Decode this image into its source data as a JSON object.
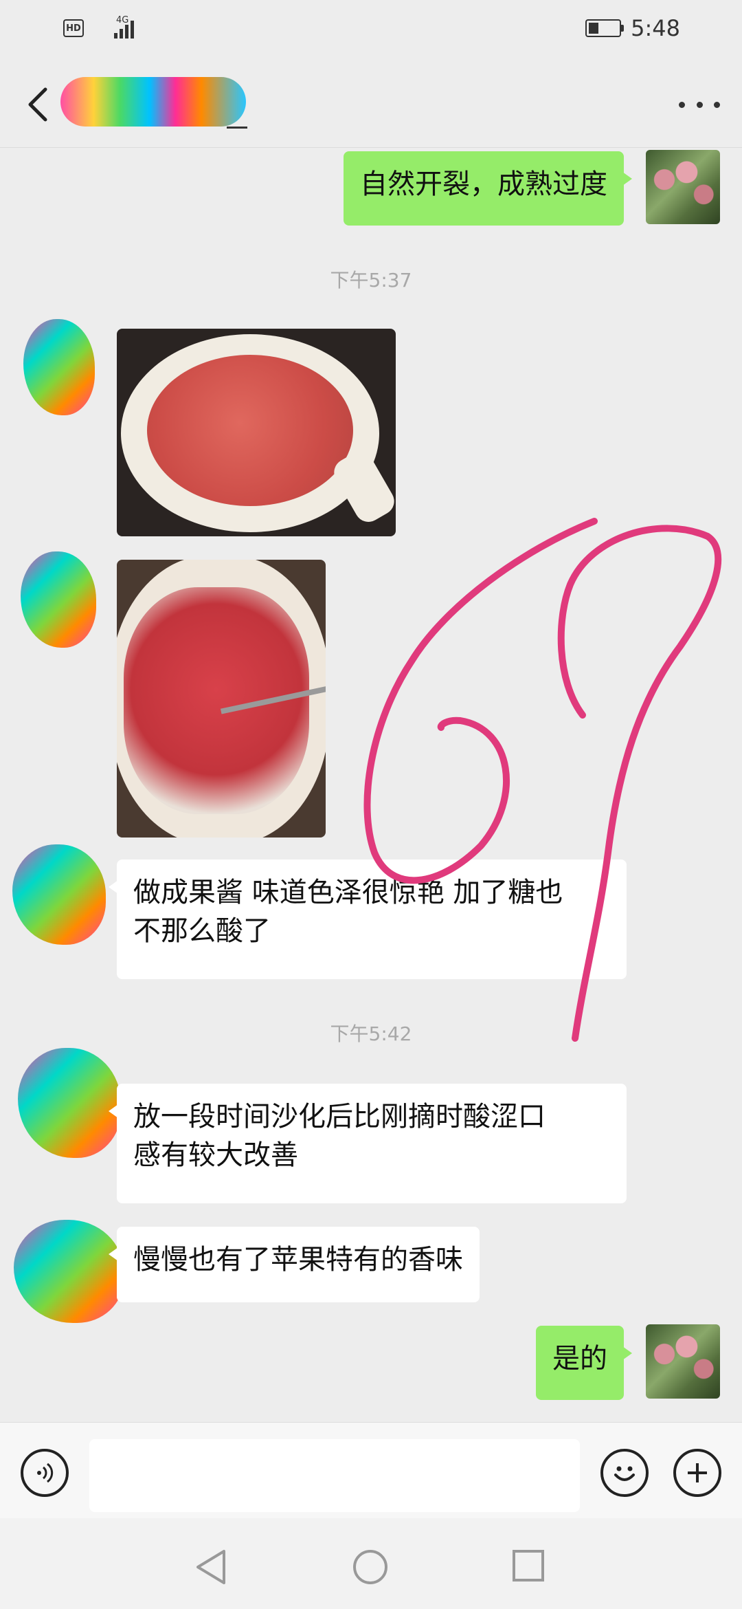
{
  "status_bar": {
    "hd_label": "HD",
    "network_label": "4G",
    "time": "5:48"
  },
  "header": {
    "back_icon": "chevron-left-icon",
    "more_icon": "more-dots-icon"
  },
  "messages": {
    "m1": {
      "side": "right",
      "text": "自然开裂，成熟过度"
    },
    "ts1": "下午5:37",
    "m2": {
      "side": "left",
      "type": "image",
      "desc": "jam-in-pan-photo"
    },
    "m3": {
      "side": "left",
      "type": "image",
      "desc": "jam-spoon-photo"
    },
    "m4": {
      "side": "left",
      "line1": "做成果酱 味道色泽很惊艳 加了糖也",
      "line2": "不那么酸了"
    },
    "ts2": "下午5:42",
    "m5": {
      "side": "left",
      "line1": "放一段时间沙化后比刚摘时酸涩口",
      "line2": "感有较大改善"
    },
    "m6": {
      "side": "left",
      "text": "慢慢也有了苹果特有的香味"
    },
    "m7": {
      "side": "right",
      "text": "是的"
    }
  },
  "input_bar": {
    "placeholder": "",
    "voice_icon": "voice-icon",
    "emoji_icon": "emoji-icon",
    "plus_icon": "plus-icon"
  },
  "colors": {
    "sent_bubble": "#95ec69",
    "received_bubble": "#ffffff",
    "background": "#ededed",
    "scribble": "#e03a7c"
  }
}
